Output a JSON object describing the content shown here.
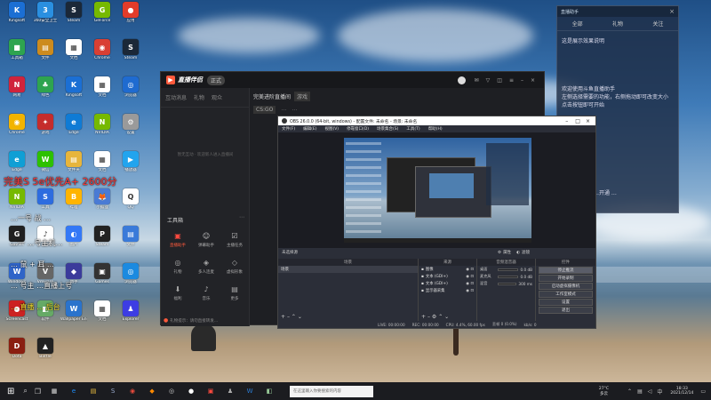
{
  "desktop": {
    "icons": [
      {
        "label": "Kingsoft",
        "color": "#1b6fd4",
        "glyph": "K"
      },
      {
        "label": "360安全卫士",
        "color": "#2a8fe0",
        "glyph": "3"
      },
      {
        "label": "Steam",
        "color": "#1b2838",
        "glyph": "S"
      },
      {
        "label": "GeForce",
        "color": "#76b900",
        "glyph": "G"
      },
      {
        "label": "应用",
        "color": "#e23c2a",
        "glyph": "●"
      },
      {
        "label": "工具箱",
        "color": "#2ea44f",
        "glyph": "■"
      },
      {
        "label": "文件",
        "color": "#cc8b1e",
        "glyph": "▤"
      },
      {
        "label": "文档",
        "color": "#ffffff",
        "glyph": "▦"
      },
      {
        "label": "Chrome",
        "color": "#d93f33",
        "glyph": "◉"
      },
      {
        "label": "Steam",
        "color": "#1b2838",
        "glyph": "S"
      },
      {
        "label": "网易",
        "color": "#d0243c",
        "glyph": "N"
      },
      {
        "label": "绿色",
        "color": "#2ea44f",
        "glyph": "♣"
      },
      {
        "label": "Kingsoft",
        "color": "#1b6fd4",
        "glyph": "K"
      },
      {
        "label": "文档",
        "color": "#ffffff",
        "glyph": "▦"
      },
      {
        "label": "浏览器",
        "color": "#1f6bd0",
        "glyph": "◎"
      },
      {
        "label": "Chrome",
        "color": "#f2b400",
        "glyph": "◉"
      },
      {
        "label": "游戏",
        "color": "#c52c2c",
        "glyph": "✦"
      },
      {
        "label": "Edge",
        "color": "#0f7bd5",
        "glyph": "e"
      },
      {
        "label": "NVIDIA",
        "color": "#76b900",
        "glyph": "N"
      },
      {
        "label": "设置",
        "color": "#9a9a9a",
        "glyph": "⚙"
      },
      {
        "label": "Edge",
        "color": "#0f9fd5",
        "glyph": "e"
      },
      {
        "label": "微信",
        "color": "#2dc100",
        "glyph": "W"
      },
      {
        "label": "文件夹",
        "color": "#e7b53c",
        "glyph": "▤"
      },
      {
        "label": "文档",
        "color": "#ffffff",
        "glyph": "▦"
      },
      {
        "label": "播放器",
        "color": "#22a4ee",
        "glyph": "▶"
      },
      {
        "label": "NVIDIA",
        "color": "#76b900",
        "glyph": "N"
      },
      {
        "label": "工具",
        "color": "#2d6cdf",
        "glyph": "S"
      },
      {
        "label": "哔哩",
        "color": "#ffb400",
        "glyph": "B"
      },
      {
        "label": "小狐狸",
        "color": "#4a7bd4",
        "glyph": "🦊"
      },
      {
        "label": "QQ",
        "color": "#ffffff",
        "glyph": "Q"
      },
      {
        "label": "Games",
        "color": "#202020",
        "glyph": "G"
      },
      {
        "label": "音乐",
        "color": "#ffffff",
        "glyph": "♪"
      },
      {
        "label": "图片",
        "color": "#3478f6",
        "glyph": "◐"
      },
      {
        "label": "Steam",
        "color": "#222",
        "glyph": "P"
      },
      {
        "label": "文件",
        "color": "#3a7ad9",
        "glyph": "▤"
      },
      {
        "label": "Windows",
        "color": "#2f64c8",
        "glyph": "W"
      },
      {
        "label": "Vmware",
        "color": "#666",
        "glyph": "V"
      },
      {
        "label": "助手",
        "color": "#3b3b9b",
        "glyph": "◆"
      },
      {
        "label": "Games",
        "color": "#333",
        "glyph": "▣"
      },
      {
        "label": "浏览器",
        "color": "#1b8ae0",
        "glyph": "◎"
      },
      {
        "label": "Screencast",
        "color": "#c22",
        "glyph": "●"
      },
      {
        "label": "软件",
        "color": "#6a6",
        "glyph": "◧"
      },
      {
        "label": "Wallpaper Engine",
        "color": "#2a73cc",
        "glyph": "W"
      },
      {
        "label": "文档",
        "color": "#ffffff",
        "glyph": "▦"
      },
      {
        "label": "Explorer",
        "color": "#3d3de3",
        "glyph": "♟"
      },
      {
        "label": "Dota",
        "color": "#8a1f11",
        "glyph": "D"
      },
      {
        "label": "Battle",
        "color": "#222",
        "glyph": "▲"
      }
    ],
    "overlay_lines": [
      {
        "text": "完美S 5e优先A+ 2600分",
        "color": "#ff3b3b",
        "size": "11px"
      },
      {
        "text": "…一号 战 …",
        "color": "#ffffff",
        "size": "8px"
      },
      {
        "text": "…一 …号主机…",
        "color": "#ffffff",
        "size": "8px"
      },
      {
        "text": "… 鼠 + 耳 …",
        "color": "#ffffff",
        "size": "8px"
      },
      {
        "text": "… 号主 …直播上号",
        "color": "#ffffff",
        "size": "8px"
      },
      {
        "text": "… 直播 … 后台",
        "color": "#f6e030",
        "size": "8px"
      }
    ]
  },
  "helper_window": {
    "title": "直播助手",
    "tabs": [
      "全部",
      "礼物",
      "关注"
    ],
    "notice": "这是展示效果说明",
    "lines": [
      "欢迎使用斗鱼直播助手",
      "左侧选择需要的功能，右侧拖动即可改变大小",
      "点击按钮即可开始"
    ],
    "footer": "礼物、道具、…开通 …"
  },
  "live_window": {
    "app_name": "直播伴侣",
    "app_badge": "正式",
    "room_title": "完美进阶直播间",
    "room_tag": "游戏",
    "sub_labels": [
      "CS:GO",
      "…",
      "…"
    ],
    "tabs": [
      "互动消息",
      "礼物",
      "观众"
    ],
    "empty_hint": "暂无互动 · 欢迎新人进入直播间",
    "toolbox_title": "工具箱",
    "tools": [
      {
        "label": "直播助手",
        "icon": "▣",
        "color": "#ff4a3f"
      },
      {
        "label": "弹幕助手",
        "icon": "☺",
        "color": "#ccc"
      },
      {
        "label": "主播任务",
        "icon": "☑",
        "color": "#ccc"
      },
      {
        "label": "礼物",
        "icon": "◎",
        "color": "#aaa"
      },
      {
        "label": "多人连麦",
        "icon": "◈",
        "color": "#aaa"
      },
      {
        "label": "虚拟形象",
        "icon": "◇",
        "color": "#aaa"
      },
      {
        "label": "福利",
        "icon": "⬇",
        "color": "#aaa"
      },
      {
        "label": "音乐",
        "icon": "♪",
        "color": "#aaa"
      },
      {
        "label": "更多",
        "icon": "▤",
        "color": "#aaa"
      }
    ],
    "footer_tip": "礼物提示：请勿直接转发…",
    "footer_btn": "开始直播"
  },
  "obs": {
    "title": "OBS 26.0.0 (64-bit, windows) - 配置文件: 未命名 - 场景: 未命名",
    "menu": [
      "文件(F)",
      "编辑(E)",
      "视图(V)",
      "停靠窗口(D)",
      "场景集合(S)",
      "工具(T)",
      "帮助(H)"
    ],
    "no_source": "未选择源",
    "props_btn": "属性",
    "filters_btn": "滤镜",
    "panels": {
      "scenes": "场景",
      "sources": "来源",
      "mixer": "音频混音器",
      "controls": "控件"
    },
    "scene_items": [
      "场景"
    ],
    "source_items": [
      "图像",
      "文本 (GDI+)",
      "文本 (GDI+)",
      "显示器采集"
    ],
    "mixer_channels": [
      {
        "name": "桌面",
        "db": "0.0 dB"
      },
      {
        "name": "麦克风",
        "db": "0.0 dB"
      },
      {
        "name": "混音",
        "db": "300 ms"
      }
    ],
    "controls": [
      "停止推流",
      "开始录制",
      "启动虚拟摄像机",
      "工作室模式",
      "设置",
      "退出"
    ],
    "status": {
      "live": "LIVE: 00:00:00",
      "rec": "REC: 00:00:00",
      "cpu": "CPU: 4.4%, 60.00 fps",
      "kb": "kb/s: 0",
      "dropped": "丢帧 0 (0.0%)"
    }
  },
  "taskbar": {
    "search_placeholder": "在这里输入你要搜索的内容",
    "weather": "27°C",
    "weather_sub": "多云",
    "time": "18:33",
    "date": "2021/12/14",
    "apps": [
      {
        "glyph": "▦",
        "color": "#ddd"
      },
      {
        "glyph": "e",
        "color": "#1e90ff"
      },
      {
        "glyph": "▤",
        "color": "#f0c040"
      },
      {
        "glyph": "S",
        "color": "#9ac"
      },
      {
        "glyph": "◉",
        "color": "#e94b3c"
      },
      {
        "glyph": "◆",
        "color": "#ff8a00"
      },
      {
        "glyph": "◎",
        "color": "#ccc"
      },
      {
        "glyph": "●",
        "color": "#fff"
      },
      {
        "glyph": "▣",
        "color": "#ff4a3f"
      },
      {
        "glyph": "♟",
        "color": "#aaa"
      },
      {
        "glyph": "W",
        "color": "#2b7cd3"
      },
      {
        "glyph": "◧",
        "color": "#9c9"
      }
    ]
  }
}
